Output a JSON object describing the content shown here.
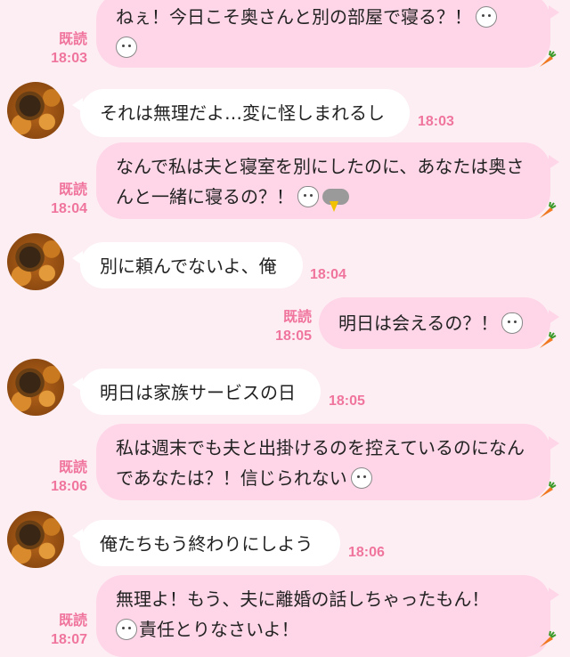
{
  "messages": [
    {
      "dir": "out",
      "text": "ねぇ！今日こそ奥さんと別の部屋で寝る？！",
      "read": "既読",
      "time": "18:03"
    },
    {
      "dir": "in",
      "text": "それは無理だよ…変に怪しまれるし",
      "time": "18:03"
    },
    {
      "dir": "out",
      "text": "なんで私は夫と寝室を別にしたのに、あなたは奥さんと一緒に寝るの？！",
      "read": "既読",
      "time": "18:04"
    },
    {
      "dir": "in",
      "text": "別に頼んでないよ、俺",
      "time": "18:04"
    },
    {
      "dir": "out",
      "text": "明日は会えるの？！",
      "read": "既読",
      "time": "18:05"
    },
    {
      "dir": "in",
      "text": "明日は家族サービスの日",
      "time": "18:05"
    },
    {
      "dir": "out",
      "text": "私は週末でも夫と出掛けるのを控えているのになんであなたは？！信じられない",
      "read": "既読",
      "time": "18:06"
    },
    {
      "dir": "in",
      "text": "俺たちもう終わりにしよう",
      "time": "18:06"
    },
    {
      "dir": "out",
      "line1": "無理よ！もう、夫に離婚の話しちゃったもん！",
      "line2": "責任とりなさいよ！",
      "read": "既読",
      "time": "18:07"
    }
  ],
  "icons": {
    "avatar": "sender-avatar",
    "sticker": "carrot-icon"
  },
  "colors": {
    "background": "#fdeef4",
    "outgoing_bubble": "#ffd6e7",
    "incoming_bubble": "#ffffff",
    "meta_text": "#f0759d"
  }
}
